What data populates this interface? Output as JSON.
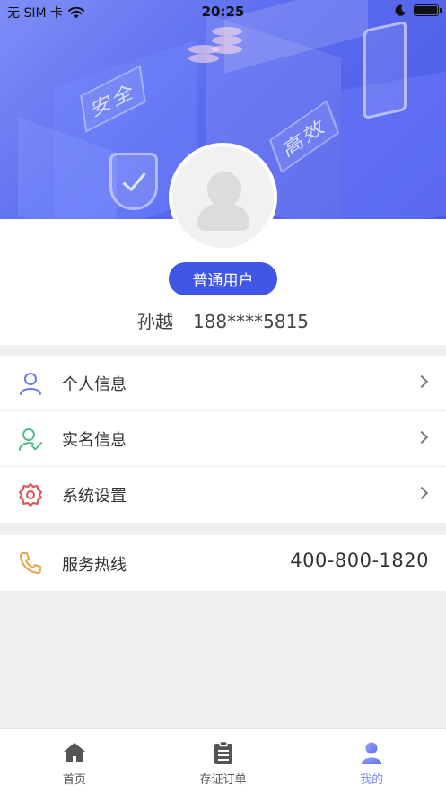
{
  "status_bar": {
    "carrier": "无 SIM 卡",
    "time": "20:25"
  },
  "banner": {
    "tag_safe": "安全",
    "tag_efficient": "高效"
  },
  "profile": {
    "badge": "普通用户",
    "name": "孙越",
    "phone": "188****5815"
  },
  "menu": {
    "items": [
      {
        "label": "个人信息",
        "icon": "user-icon",
        "color": "#6b7be8"
      },
      {
        "label": "实名信息",
        "icon": "user-verified-icon",
        "color": "#4cc08a"
      },
      {
        "label": "系统设置",
        "icon": "gear-icon",
        "color": "#e0524f"
      }
    ]
  },
  "service": {
    "label": "服务热线",
    "phone": "400-800-1820",
    "icon": "phone-icon",
    "color": "#e8a64a"
  },
  "tabbar": {
    "tabs": [
      {
        "label": "首页",
        "icon": "home-icon",
        "active": false
      },
      {
        "label": "存证订单",
        "icon": "clipboard-icon",
        "active": false
      },
      {
        "label": "我的",
        "icon": "profile-icon",
        "active": true
      }
    ],
    "active_color": "#7f8cf2"
  }
}
